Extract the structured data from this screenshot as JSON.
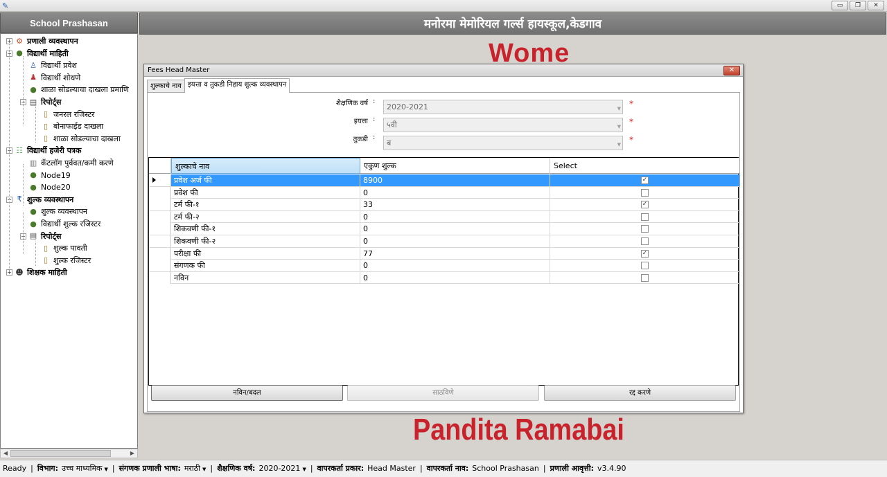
{
  "window": {
    "minimize": "▭",
    "restore": "❐",
    "close": "✕"
  },
  "left_header": "School Prashasan",
  "school_name": "मनोरमा मेमोरियल गर्ल्स हायस्कूल,केडगाव",
  "background": {
    "top_text": "Wome",
    "bottom_text": "Pandita Ramabai"
  },
  "tree": [
    {
      "label": "प्रणाली व्यवस्थापन",
      "bold": true,
      "level": 0,
      "expander": "+",
      "icon": "gear-icon"
    },
    {
      "label": "विद्यार्थी माहिती",
      "bold": true,
      "level": 0,
      "expander": "−",
      "icon": "student-icon"
    },
    {
      "label": "विद्यार्थी प्रवेश",
      "bold": false,
      "level": 1,
      "icon": "admission-icon"
    },
    {
      "label": "विद्यार्थी शोधणे",
      "bold": false,
      "level": 1,
      "icon": "search-student-icon"
    },
    {
      "label": "शाळा सोडल्याचा दाखला प्रमाणि",
      "bold": false,
      "level": 1,
      "icon": "certificate-icon"
    },
    {
      "label": "रिपोर्ट्स",
      "bold": true,
      "level": 1,
      "expander": "−",
      "icon": "report-icon"
    },
    {
      "label": "जनरल रजिस्टर",
      "bold": false,
      "level": 2,
      "icon": "document-icon"
    },
    {
      "label": "बोनाफाईड दाखला",
      "bold": false,
      "level": 2,
      "icon": "document-icon"
    },
    {
      "label": "शाळा सोडल्याचा दाखला",
      "bold": false,
      "level": 2,
      "icon": "document-icon"
    },
    {
      "label": "विद्यार्थी हजेरी पत्रक",
      "bold": true,
      "level": 0,
      "expander": "−",
      "icon": "attendance-icon"
    },
    {
      "label": "कॅटलॉग पुर्ववत/कमी करणे",
      "bold": false,
      "level": 1,
      "icon": "catalog-icon"
    },
    {
      "label": "Node19",
      "bold": false,
      "level": 1,
      "icon": "student-icon"
    },
    {
      "label": "Node20",
      "bold": false,
      "level": 1,
      "icon": "student-icon"
    },
    {
      "label": "शुल्क व्यवस्थापन",
      "bold": true,
      "level": 0,
      "expander": "−",
      "icon": "rupee-icon"
    },
    {
      "label": "शुल्क व्यवस्थापन",
      "bold": false,
      "level": 1,
      "icon": "student-icon"
    },
    {
      "label": "विद्यार्थी शुल्क रजिस्टर",
      "bold": false,
      "level": 1,
      "icon": "student-icon"
    },
    {
      "label": "रिपोर्ट्स",
      "bold": true,
      "level": 1,
      "expander": "−",
      "icon": "report-icon"
    },
    {
      "label": "शुल्क पावती",
      "bold": false,
      "level": 2,
      "icon": "document-icon"
    },
    {
      "label": "शुल्क रजिस्टर",
      "bold": false,
      "level": 2,
      "icon": "document-icon"
    },
    {
      "label": "शिक्षक माहिती",
      "bold": true,
      "level": 0,
      "expander": "+",
      "icon": "teacher-icon"
    }
  ],
  "dialog": {
    "title": "Fees Head Master",
    "close": "✕",
    "tabs": [
      "शुल्काचे नाव",
      "इयत्ता व तुकडी निहाय शुल्क व्यवस्थापन"
    ],
    "active_tab": 1,
    "form": {
      "year_label": "शैक्षणिक वर्ष",
      "year_value": "2020-2021",
      "class_label": "इयत्ता",
      "class_value": "५वी",
      "division_label": "तुकडी",
      "division_value": "ब",
      "colon": ":",
      "required": "*"
    },
    "grid": {
      "columns": [
        "शुल्काचे नाव",
        "एकुण शुल्क",
        "Select"
      ],
      "rows": [
        {
          "name": "प्रवेश अर्ज फी",
          "amount": "8900",
          "checked": true
        },
        {
          "name": "प्रवेश फी",
          "amount": "0",
          "checked": false
        },
        {
          "name": "टर्म फी-१",
          "amount": "33",
          "checked": true
        },
        {
          "name": "टर्म फी-२",
          "amount": "0",
          "checked": false
        },
        {
          "name": "शिकवणी फी-१",
          "amount": "0",
          "checked": false
        },
        {
          "name": "शिकवणी फी-२",
          "amount": "0",
          "checked": false
        },
        {
          "name": "परीक्षा फी",
          "amount": "77",
          "checked": true
        },
        {
          "name": "संगणक फी",
          "amount": "0",
          "checked": false
        },
        {
          "name": "नविन",
          "amount": "0",
          "checked": false
        }
      ],
      "selected_row": 0
    },
    "buttons": {
      "new": "नविन/बदल",
      "save": "साठविणे",
      "cancel": "रद्द करणे"
    }
  },
  "status": {
    "ready": "Ready",
    "dept_label": "विभाग:",
    "dept_value": "उच्च माध्यमिक",
    "lang_label": "संगणक प्रणाली भाषा:",
    "lang_value": "मराठी",
    "year_label": "शैक्षणिक वर्ष:",
    "year_value": "2020-2021",
    "usertype_label": "वापरकर्ता प्रकार:",
    "usertype_value": "Head Master",
    "username_label": "वापरकर्ता नाव:",
    "username_value": "School Prashasan",
    "version_label": "प्रणाली आवृत्ती:",
    "version_value": "v3.4.90",
    "sep": "|"
  }
}
